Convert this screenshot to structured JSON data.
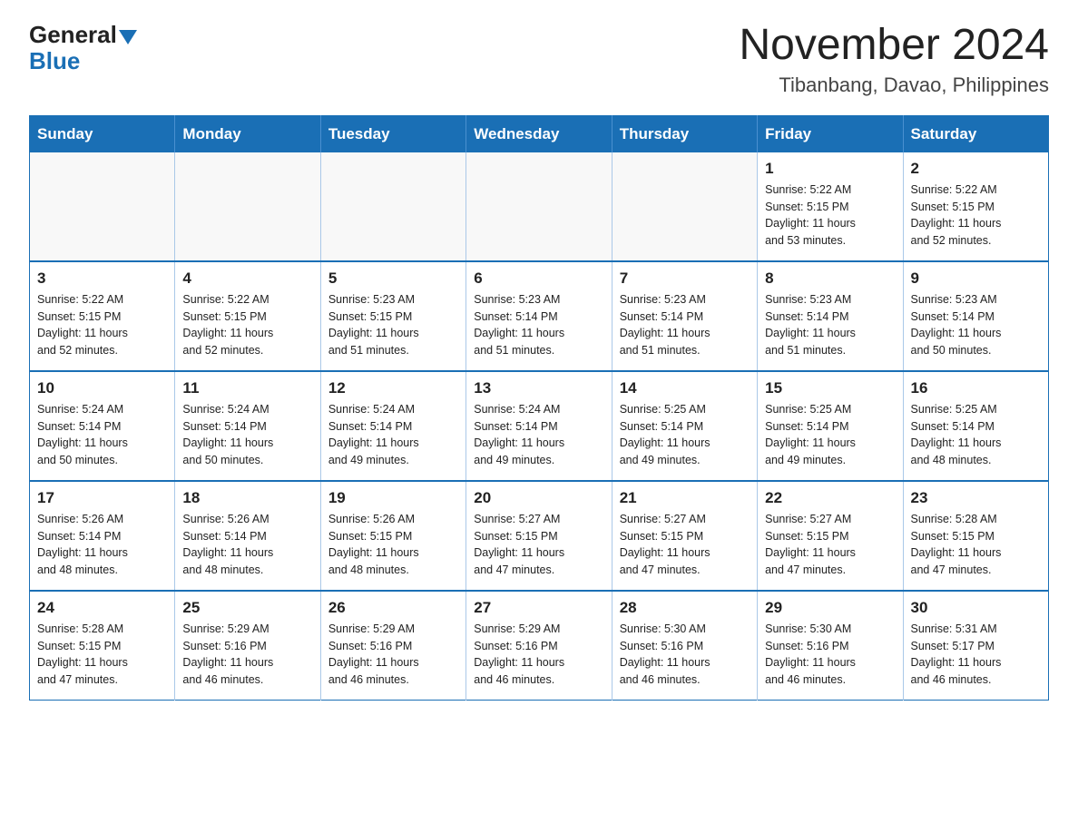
{
  "logo": {
    "general": "General",
    "blue": "Blue"
  },
  "header": {
    "month": "November 2024",
    "location": "Tibanbang, Davao, Philippines"
  },
  "weekdays": [
    "Sunday",
    "Monday",
    "Tuesday",
    "Wednesday",
    "Thursday",
    "Friday",
    "Saturday"
  ],
  "weeks": [
    [
      {
        "day": "",
        "info": ""
      },
      {
        "day": "",
        "info": ""
      },
      {
        "day": "",
        "info": ""
      },
      {
        "day": "",
        "info": ""
      },
      {
        "day": "",
        "info": ""
      },
      {
        "day": "1",
        "info": "Sunrise: 5:22 AM\nSunset: 5:15 PM\nDaylight: 11 hours\nand 53 minutes."
      },
      {
        "day": "2",
        "info": "Sunrise: 5:22 AM\nSunset: 5:15 PM\nDaylight: 11 hours\nand 52 minutes."
      }
    ],
    [
      {
        "day": "3",
        "info": "Sunrise: 5:22 AM\nSunset: 5:15 PM\nDaylight: 11 hours\nand 52 minutes."
      },
      {
        "day": "4",
        "info": "Sunrise: 5:22 AM\nSunset: 5:15 PM\nDaylight: 11 hours\nand 52 minutes."
      },
      {
        "day": "5",
        "info": "Sunrise: 5:23 AM\nSunset: 5:15 PM\nDaylight: 11 hours\nand 51 minutes."
      },
      {
        "day": "6",
        "info": "Sunrise: 5:23 AM\nSunset: 5:14 PM\nDaylight: 11 hours\nand 51 minutes."
      },
      {
        "day": "7",
        "info": "Sunrise: 5:23 AM\nSunset: 5:14 PM\nDaylight: 11 hours\nand 51 minutes."
      },
      {
        "day": "8",
        "info": "Sunrise: 5:23 AM\nSunset: 5:14 PM\nDaylight: 11 hours\nand 51 minutes."
      },
      {
        "day": "9",
        "info": "Sunrise: 5:23 AM\nSunset: 5:14 PM\nDaylight: 11 hours\nand 50 minutes."
      }
    ],
    [
      {
        "day": "10",
        "info": "Sunrise: 5:24 AM\nSunset: 5:14 PM\nDaylight: 11 hours\nand 50 minutes."
      },
      {
        "day": "11",
        "info": "Sunrise: 5:24 AM\nSunset: 5:14 PM\nDaylight: 11 hours\nand 50 minutes."
      },
      {
        "day": "12",
        "info": "Sunrise: 5:24 AM\nSunset: 5:14 PM\nDaylight: 11 hours\nand 49 minutes."
      },
      {
        "day": "13",
        "info": "Sunrise: 5:24 AM\nSunset: 5:14 PM\nDaylight: 11 hours\nand 49 minutes."
      },
      {
        "day": "14",
        "info": "Sunrise: 5:25 AM\nSunset: 5:14 PM\nDaylight: 11 hours\nand 49 minutes."
      },
      {
        "day": "15",
        "info": "Sunrise: 5:25 AM\nSunset: 5:14 PM\nDaylight: 11 hours\nand 49 minutes."
      },
      {
        "day": "16",
        "info": "Sunrise: 5:25 AM\nSunset: 5:14 PM\nDaylight: 11 hours\nand 48 minutes."
      }
    ],
    [
      {
        "day": "17",
        "info": "Sunrise: 5:26 AM\nSunset: 5:14 PM\nDaylight: 11 hours\nand 48 minutes."
      },
      {
        "day": "18",
        "info": "Sunrise: 5:26 AM\nSunset: 5:14 PM\nDaylight: 11 hours\nand 48 minutes."
      },
      {
        "day": "19",
        "info": "Sunrise: 5:26 AM\nSunset: 5:15 PM\nDaylight: 11 hours\nand 48 minutes."
      },
      {
        "day": "20",
        "info": "Sunrise: 5:27 AM\nSunset: 5:15 PM\nDaylight: 11 hours\nand 47 minutes."
      },
      {
        "day": "21",
        "info": "Sunrise: 5:27 AM\nSunset: 5:15 PM\nDaylight: 11 hours\nand 47 minutes."
      },
      {
        "day": "22",
        "info": "Sunrise: 5:27 AM\nSunset: 5:15 PM\nDaylight: 11 hours\nand 47 minutes."
      },
      {
        "day": "23",
        "info": "Sunrise: 5:28 AM\nSunset: 5:15 PM\nDaylight: 11 hours\nand 47 minutes."
      }
    ],
    [
      {
        "day": "24",
        "info": "Sunrise: 5:28 AM\nSunset: 5:15 PM\nDaylight: 11 hours\nand 47 minutes."
      },
      {
        "day": "25",
        "info": "Sunrise: 5:29 AM\nSunset: 5:16 PM\nDaylight: 11 hours\nand 46 minutes."
      },
      {
        "day": "26",
        "info": "Sunrise: 5:29 AM\nSunset: 5:16 PM\nDaylight: 11 hours\nand 46 minutes."
      },
      {
        "day": "27",
        "info": "Sunrise: 5:29 AM\nSunset: 5:16 PM\nDaylight: 11 hours\nand 46 minutes."
      },
      {
        "day": "28",
        "info": "Sunrise: 5:30 AM\nSunset: 5:16 PM\nDaylight: 11 hours\nand 46 minutes."
      },
      {
        "day": "29",
        "info": "Sunrise: 5:30 AM\nSunset: 5:16 PM\nDaylight: 11 hours\nand 46 minutes."
      },
      {
        "day": "30",
        "info": "Sunrise: 5:31 AM\nSunset: 5:17 PM\nDaylight: 11 hours\nand 46 minutes."
      }
    ]
  ]
}
